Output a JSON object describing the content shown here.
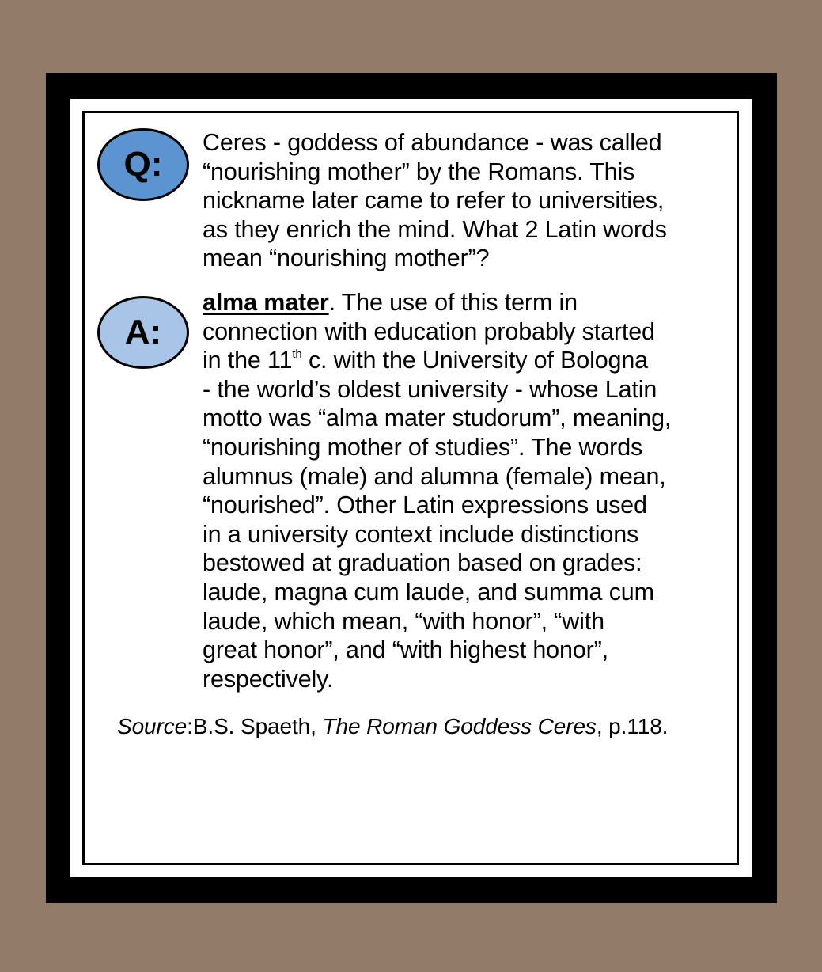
{
  "question": {
    "badge": "Q:",
    "lines": [
      "Ceres - goddess of abundance - was called",
      "“nourishing mother” by the Romans. This",
      "nickname later came to refer to universities,",
      "as they enrich the mind. What 2 Latin words",
      "mean “nourishing mother”?"
    ]
  },
  "answer": {
    "badge": "A:",
    "term": "alma mater",
    "line1_rest": ". The use of this term in",
    "line2": "connection with education probably started",
    "line3_pre": "in the 11",
    "line3_sup": "th",
    "line3_post": " c. with the University of Bologna",
    "lines_rest": [
      "- the world’s oldest university - whose Latin",
      "motto was “alma mater studorum”, meaning,",
      "“nourishing mother of studies”. The words",
      "alumnus (male) and alumna (female) mean,",
      "“nourished”. Other Latin expressions used",
      "in a university context include distinctions",
      "bestowed at graduation based on grades:",
      "laude, magna cum laude, and summa cum",
      "laude, which mean, “with honor”, “with",
      "great honor”, and “with highest honor”,",
      "respectively."
    ]
  },
  "source": {
    "label": "Source",
    "colon": ":",
    "author": "B.S. Spaeth, ",
    "title": "The Roman Goddess Ceres",
    "page": ", p.118."
  },
  "colors": {
    "background": "#937b6a",
    "q_badge": "#5b94d0",
    "a_badge": "#a8c4e6"
  }
}
